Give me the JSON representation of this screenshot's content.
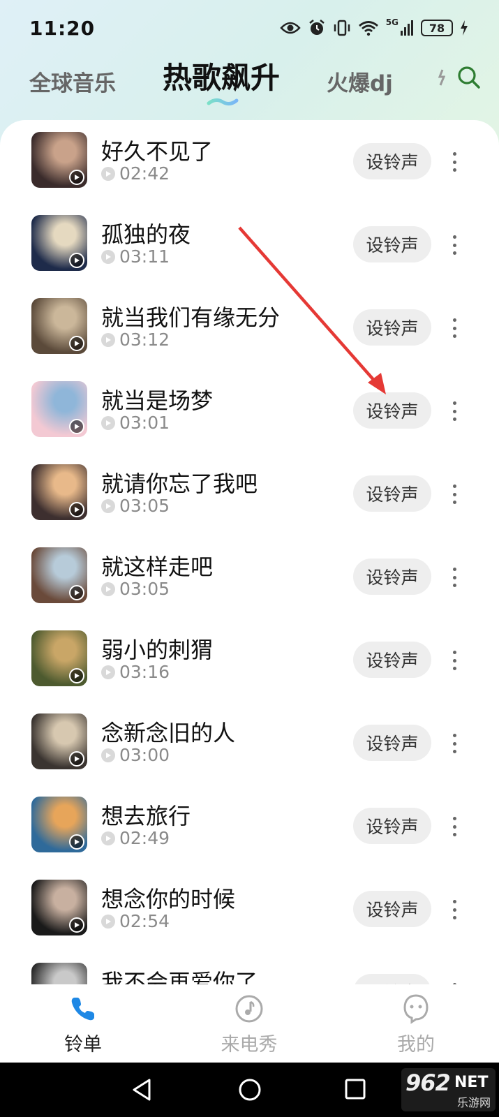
{
  "status_bar": {
    "time": "11:20",
    "network": "5G",
    "battery": "78"
  },
  "tabs": [
    {
      "label": "全球音乐",
      "active": false
    },
    {
      "label": "热歌飙升",
      "active": true
    },
    {
      "label": "火爆dj",
      "active": false
    }
  ],
  "songs": [
    {
      "title": "好久不见了",
      "duration": "02:42",
      "cover_colors": [
        "#3a2b2b",
        "#c9a28a"
      ]
    },
    {
      "title": "孤独的夜",
      "duration": "03:11",
      "cover_colors": [
        "#1e2b4a",
        "#e5d9c0"
      ]
    },
    {
      "title": "就当我们有缘无分",
      "duration": "03:12",
      "cover_colors": [
        "#5b4a3a",
        "#cbb79a"
      ]
    },
    {
      "title": "就当是场梦",
      "duration": "03:01",
      "cover_colors": [
        "#f3c9d3",
        "#8fb6d9"
      ]
    },
    {
      "title": "就请你忘了我吧",
      "duration": "03:05",
      "cover_colors": [
        "#3d2f2f",
        "#e8b98a"
      ]
    },
    {
      "title": "就这样走吧",
      "duration": "03:05",
      "cover_colors": [
        "#6a4a3a",
        "#b7cbd9"
      ]
    },
    {
      "title": "弱小的刺猬",
      "duration": "03:16",
      "cover_colors": [
        "#4d5a2f",
        "#c9a667"
      ]
    },
    {
      "title": "念新念旧的人",
      "duration": "03:00",
      "cover_colors": [
        "#3a3430",
        "#d7c8b0"
      ]
    },
    {
      "title": "想去旅行",
      "duration": "02:49",
      "cover_colors": [
        "#2f6a9a",
        "#e7a55a"
      ]
    },
    {
      "title": "想念你的时候",
      "duration": "02:54",
      "cover_colors": [
        "#1a1a1a",
        "#c8b0a0"
      ]
    },
    {
      "title": "我不会再爱你了",
      "duration": "",
      "cover_colors": [
        "#2a2a2a",
        "#c9c9c9"
      ]
    }
  ],
  "set_ringtone_label": "设铃声",
  "bottom_nav": [
    {
      "label": "铃单",
      "icon": "phone-icon",
      "active": true
    },
    {
      "label": "来电秀",
      "icon": "music-note-icon",
      "active": false
    },
    {
      "label": "我的",
      "icon": "ghost-face-icon",
      "active": false
    }
  ],
  "watermark": {
    "brand": "962",
    "domain": "NET",
    "subtitle": "乐游网"
  },
  "accent_color": "#1e88e5"
}
